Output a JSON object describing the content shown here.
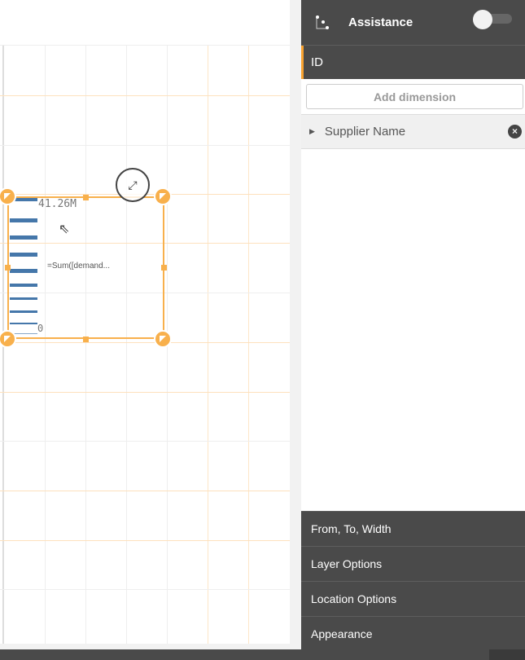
{
  "canvas": {
    "chart": {
      "max_label": "41.26M",
      "min_label": "0",
      "measure_label": "=Sum([demand...",
      "bar_color": "#4577aa"
    },
    "selection_color": "#f8b04c"
  },
  "panel": {
    "header": {
      "title": "Assistance",
      "icon": "scatter-icon",
      "toggle_on": false
    },
    "active_section": "ID",
    "add_dimension_label": "Add dimension",
    "dimensions": [
      {
        "label": "Supplier Name"
      }
    ],
    "sections": [
      {
        "label": "From, To, Width"
      },
      {
        "label": "Layer Options"
      },
      {
        "label": "Location Options"
      },
      {
        "label": "Appearance"
      }
    ],
    "accent": "#f8a230"
  }
}
